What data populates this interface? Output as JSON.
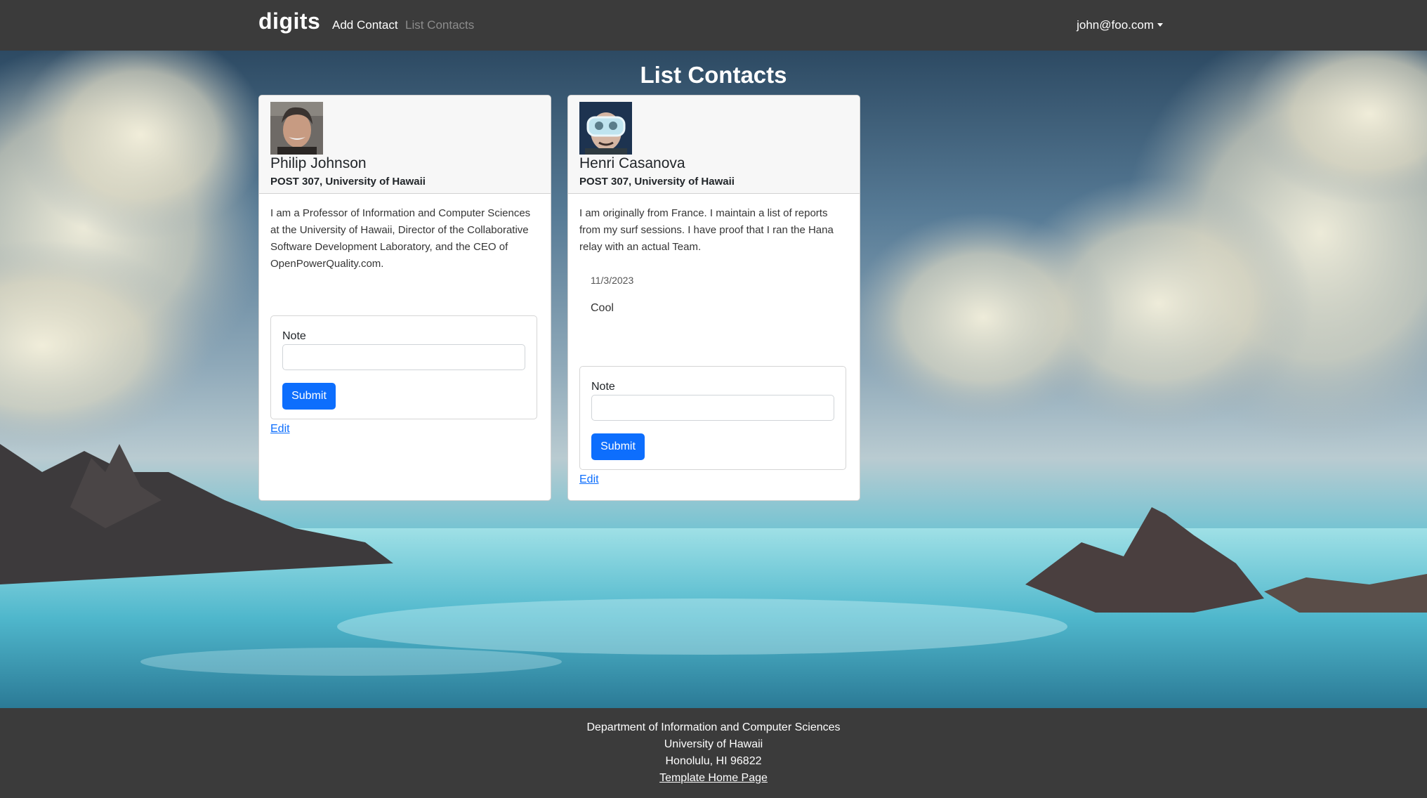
{
  "navbar": {
    "brand": "digits",
    "add_contact": "Add Contact",
    "list_contacts": "List Contacts",
    "user": "john@foo.com"
  },
  "page": {
    "title": "List Contacts"
  },
  "contacts": [
    {
      "name": "Philip Johnson",
      "address": "POST 307, University of Hawaii",
      "description": "I am a Professor of Information and Computer Sciences at the University of Hawaii, Director of the Collaborative Software Development Laboratory, and the CEO of OpenPowerQuality.com.",
      "notes": [],
      "note_label": "Note",
      "note_value": "",
      "submit_label": "Submit",
      "edit_label": "Edit"
    },
    {
      "name": "Henri Casanova",
      "address": "POST 307, University of Hawaii",
      "description": "I am originally from France. I maintain a list of reports from my surf sessions. I have proof that I ran the Hana relay with an actual Team.",
      "notes": [
        {
          "date": "11/3/2023",
          "text": "Cool"
        }
      ],
      "note_label": "Note",
      "note_value": "",
      "submit_label": "Submit",
      "edit_label": "Edit"
    }
  ],
  "footer": {
    "line1": "Department of Information and Computer Sciences",
    "line2": "University of Hawaii",
    "line3": "Honolulu, HI 96822",
    "link": "Template Home Page"
  },
  "colors": {
    "navbar_bg": "#3b3b3b",
    "primary": "#0d6efd",
    "muted_link": "#8c8c8c"
  }
}
